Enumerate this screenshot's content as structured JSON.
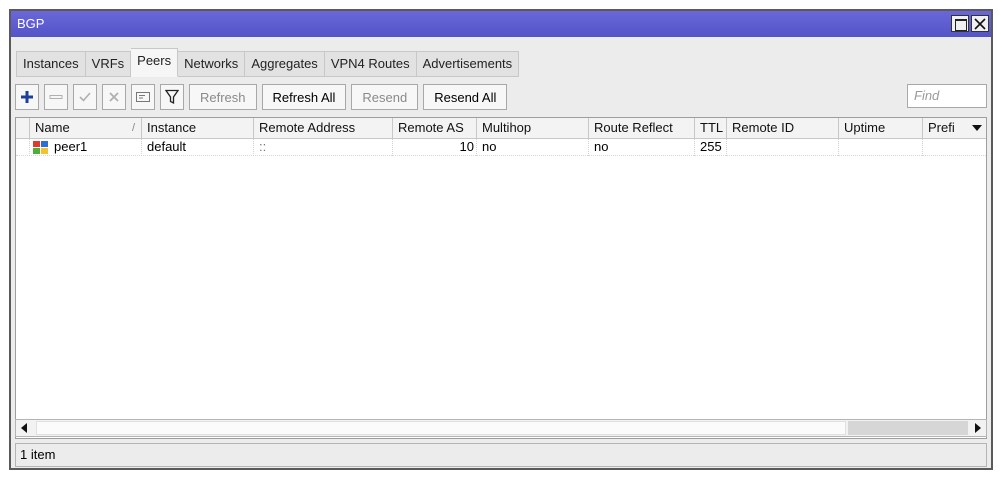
{
  "window": {
    "title": "BGP"
  },
  "tabs": [
    {
      "label": "Instances",
      "active": false
    },
    {
      "label": "VRFs",
      "active": false
    },
    {
      "label": "Peers",
      "active": true
    },
    {
      "label": "Networks",
      "active": false
    },
    {
      "label": "Aggregates",
      "active": false
    },
    {
      "label": "VPN4 Routes",
      "active": false
    },
    {
      "label": "Advertisements",
      "active": false
    }
  ],
  "toolbar": {
    "refresh_label": "Refresh",
    "refresh_all_label": "Refresh All",
    "resend_label": "Resend",
    "resend_all_label": "Resend All",
    "find_placeholder": "Find"
  },
  "table": {
    "columns": [
      "Name",
      "Instance",
      "Remote Address",
      "Remote AS",
      "Multihop",
      "Route Reflect",
      "TTL",
      "Remote ID",
      "Uptime",
      "Prefi"
    ],
    "sort_indicator": "/",
    "rows": [
      {
        "name": "peer1",
        "instance": "default",
        "remote_address": "::",
        "remote_as": "10",
        "multihop": "no",
        "route_reflect": "no",
        "ttl": "255",
        "remote_id": "",
        "uptime": "",
        "prefix": ""
      }
    ]
  },
  "status": {
    "text": "1 item"
  },
  "colors": {
    "titlebar": "#5f5ed0",
    "add_icon": "#1c3f9a",
    "peer_icon_red": "#e03a2f",
    "peer_icon_blue": "#2e6fd6",
    "peer_icon_green": "#4caf3b",
    "peer_icon_yellow": "#f2c230"
  }
}
